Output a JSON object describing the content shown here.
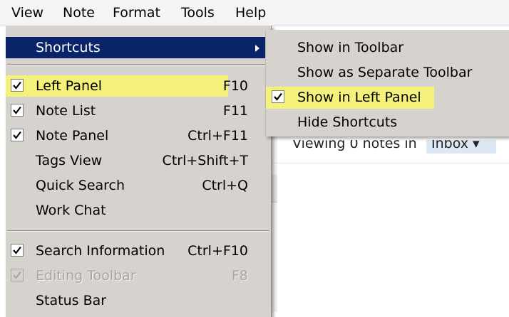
{
  "menubar": {
    "items": [
      "View",
      "Note",
      "Format",
      "Tools",
      "Help"
    ]
  },
  "view_menu": {
    "shortcuts": "Shortcuts",
    "left_panel": {
      "label": "Left Panel",
      "shortcut": "F10"
    },
    "note_list": {
      "label": "Note List",
      "shortcut": "F11"
    },
    "note_panel": {
      "label": "Note Panel",
      "shortcut": "Ctrl+F11"
    },
    "tags_view": {
      "label": "Tags View",
      "shortcut": "Ctrl+Shift+T"
    },
    "quick_search": {
      "label": "Quick Search",
      "shortcut": "Ctrl+Q"
    },
    "work_chat": {
      "label": "Work Chat"
    },
    "search_information": {
      "label": "Search Information",
      "shortcut": "Ctrl+F10"
    },
    "editing_toolbar": {
      "label": "Editing Toolbar",
      "shortcut": "F8"
    },
    "status_bar": {
      "label": "Status Bar"
    }
  },
  "shortcuts_submenu": {
    "show_in_toolbar": "Show in Toolbar",
    "show_as_separate_toolbar": "Show as Separate Toolbar",
    "show_in_left_panel": "Show in Left Panel",
    "hide_shortcuts": "Hide Shortcuts"
  },
  "note_list_header": {
    "viewing": "Viewing 0 notes in",
    "notebook": "Inbox ▾"
  },
  "colors": {
    "menu_bg": "#d6d3ce",
    "selection": "#0a246a",
    "highlight": "#f4f27a"
  }
}
